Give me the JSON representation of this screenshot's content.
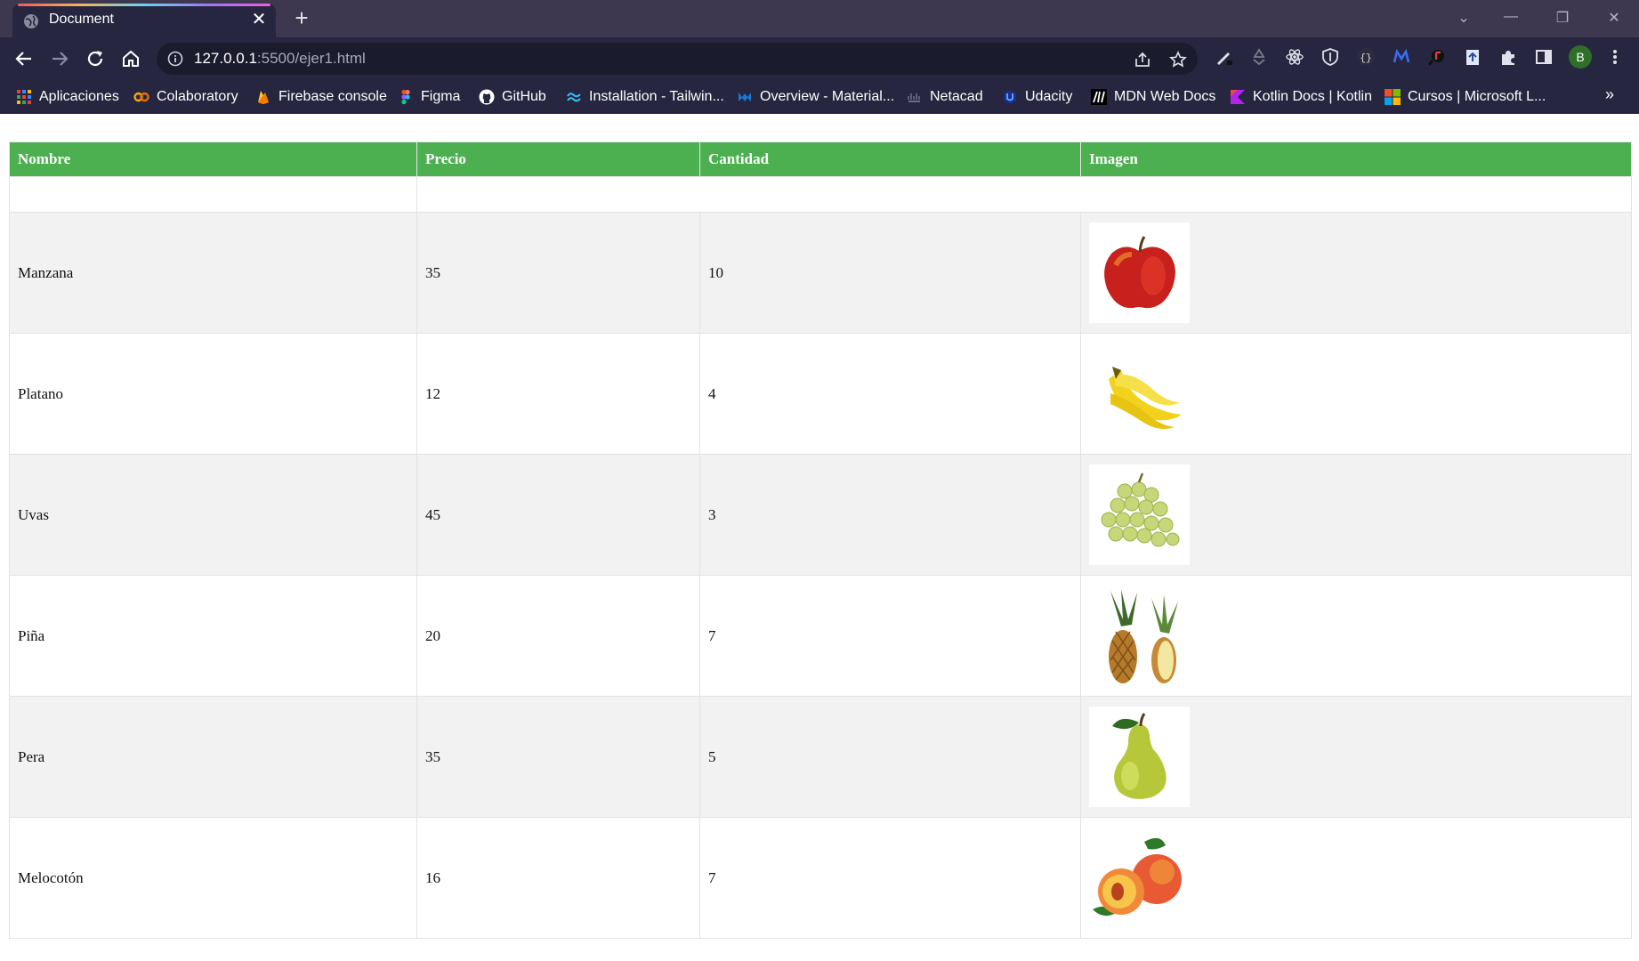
{
  "browser": {
    "tab_title": "Document",
    "tab_close": "✕",
    "new_tab": "+",
    "url_host": "127.0.0.1",
    "url_path": ":5500/ejer1.html",
    "avatar_letter": "B",
    "bookmarks_more": "»",
    "bookmarks": [
      {
        "label": "Aplicaciones",
        "icon": "apps-grid-icon"
      },
      {
        "label": "Colaboratory",
        "icon": "colab-icon"
      },
      {
        "label": "Firebase console",
        "icon": "firebase-icon"
      },
      {
        "label": "Figma",
        "icon": "figma-icon"
      },
      {
        "label": "GitHub",
        "icon": "github-icon"
      },
      {
        "label": "Installation - Tailwin...",
        "icon": "tailwind-icon"
      },
      {
        "label": "Overview - Material...",
        "icon": "material-icon"
      },
      {
        "label": "Netacad",
        "icon": "netacad-icon"
      },
      {
        "label": "Udacity",
        "icon": "udacity-icon"
      },
      {
        "label": "MDN Web Docs",
        "icon": "mdn-icon"
      },
      {
        "label": "Kotlin Docs | Kotlin",
        "icon": "kotlin-icon"
      },
      {
        "label": "Cursos | Microsoft L...",
        "icon": "microsoft-icon"
      }
    ]
  },
  "table": {
    "headers": [
      "Nombre",
      "Precio",
      "Cantidad",
      "Imagen"
    ],
    "rows": [
      {
        "nombre": "Manzana",
        "precio": "35",
        "cantidad": "10",
        "imagen": "apple-image"
      },
      {
        "nombre": "Platano",
        "precio": "12",
        "cantidad": "4",
        "imagen": "banana-image"
      },
      {
        "nombre": "Uvas",
        "precio": "45",
        "cantidad": "3",
        "imagen": "grapes-image"
      },
      {
        "nombre": "Piña",
        "precio": "20",
        "cantidad": "7",
        "imagen": "pineapple-image"
      },
      {
        "nombre": "Pera",
        "precio": "35",
        "cantidad": "5",
        "imagen": "pear-image"
      },
      {
        "nombre": "Melocotón",
        "precio": "16",
        "cantidad": "7",
        "imagen": "peach-image"
      }
    ]
  },
  "colors": {
    "header_green": "#4caf50",
    "row_stripe": "#f2f2f2",
    "chrome_dark": "#262640",
    "titlebar": "#3d3750"
  }
}
